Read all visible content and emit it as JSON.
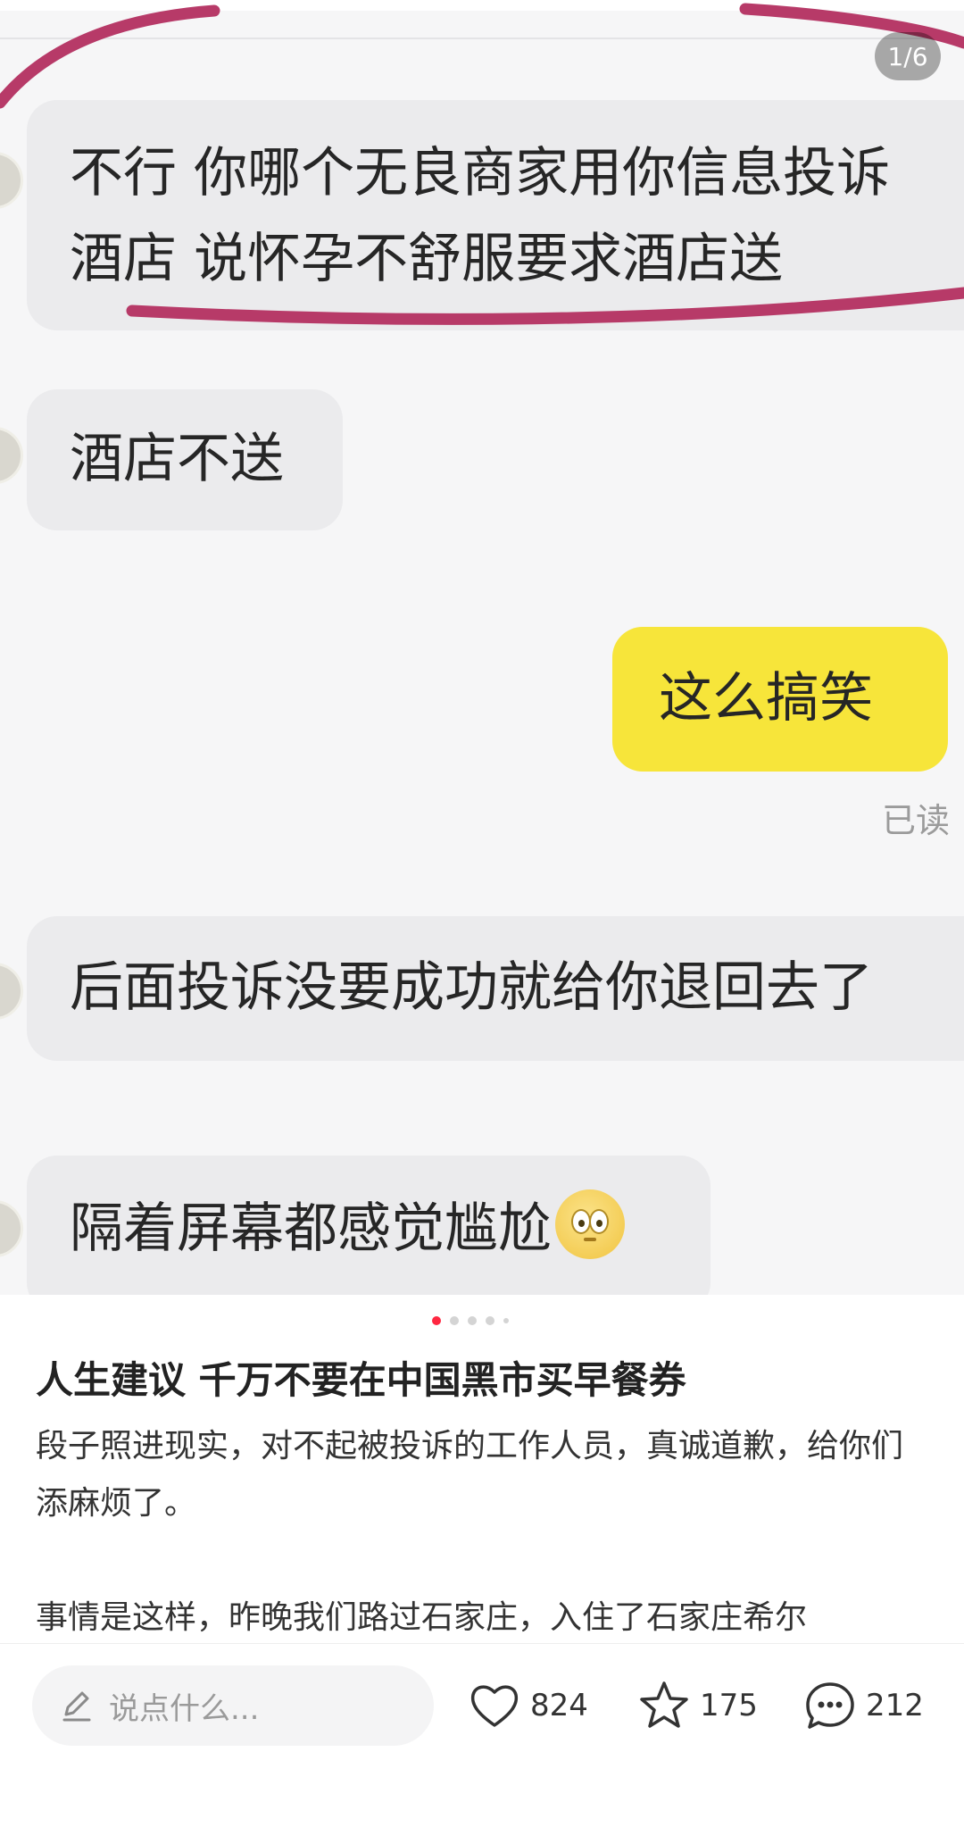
{
  "image": {
    "counter": "1/6",
    "messages": [
      {
        "text": "不行 你哪个无良商家用你信息投诉酒店 说怀孕不舒服要求酒店送",
        "line1": "不行 你哪个无良商家用你信息投诉",
        "line2": "酒店 说怀孕不舒服要求酒店送"
      },
      {
        "text": "酒店不送"
      },
      {
        "text": "这么搞笑",
        "read_status": "已读"
      },
      {
        "text": "后面投诉没要成功就给你退回去了"
      },
      {
        "text": "隔着屏幕都感觉尴尬",
        "emoji": "flushed-face-emoji"
      }
    ]
  },
  "carousel": {
    "count": 5,
    "active_index": 0
  },
  "post": {
    "title": "人生建议 千万不要在中国黑市买早餐券",
    "para1": "段子照进现实，对不起被投诉的工作人员，真诚道歉，给你们添麻烦了。",
    "para2": "事情是这样，昨晚我们路过石家庄，入住了石家庄希尔"
  },
  "bottom_bar": {
    "comment_placeholder": "说点什么...",
    "likes": "824",
    "favorites": "175",
    "comments": "212"
  },
  "colors": {
    "highlight": "#b73a68",
    "accent": "#ff2741",
    "yellow_bubble": "#f7e53a"
  },
  "icons": [
    "pencil-icon",
    "heart-icon",
    "star-icon",
    "comment-icon"
  ]
}
